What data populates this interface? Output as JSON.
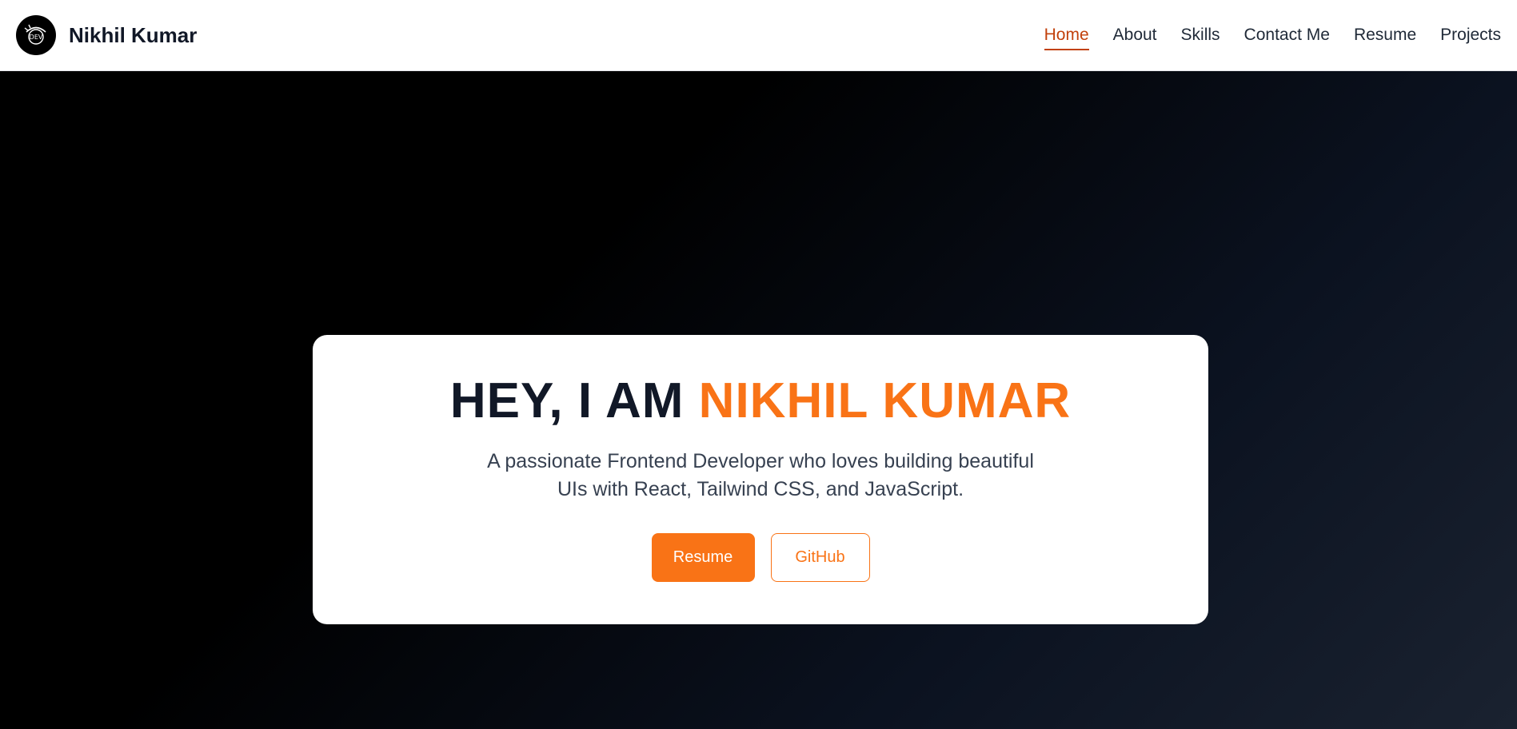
{
  "brand": {
    "logo_text": "DEV",
    "name": "Nikhil Kumar"
  },
  "nav": {
    "items": [
      {
        "label": "Home",
        "active": true
      },
      {
        "label": "About"
      },
      {
        "label": "Skills"
      },
      {
        "label": "Contact Me"
      },
      {
        "label": "Resume"
      },
      {
        "label": "Projects"
      }
    ]
  },
  "hero": {
    "headline_prefix": "HEY, I AM ",
    "headline_name": "NIKHIL KUMAR",
    "subtitle": "A passionate Frontend Developer who loves building beautiful UIs with React, Tailwind CSS, and JavaScript.",
    "primary_button": "Resume",
    "secondary_button": "GitHub"
  },
  "colors": {
    "accent": "#f97316",
    "nav_active": "#c2410c",
    "heading": "#111827"
  }
}
